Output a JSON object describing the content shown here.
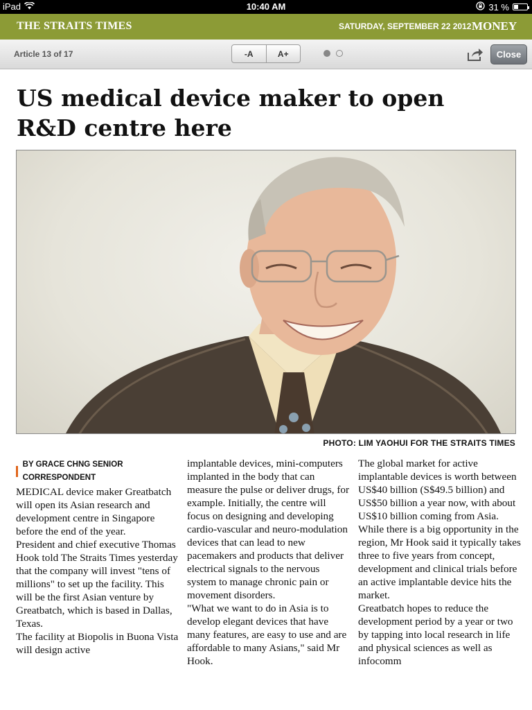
{
  "status_bar": {
    "device": "iPad",
    "time": "10:40 AM",
    "battery": "31 %",
    "battery_level": 0.31
  },
  "masthead": {
    "brand": "THE STRAITS TIMES",
    "date": "SATURDAY, SEPTEMBER 22 2012",
    "section": "MONEY"
  },
  "toolbar": {
    "article_count": "Article 13 of 17",
    "font_decrease": "-A",
    "font_increase": "A+",
    "close": "Close",
    "page_dots": {
      "current": 1,
      "total": 2
    }
  },
  "article": {
    "headline": "US medical device maker to open R&D centre here",
    "photo_credit": "PHOTO: LIM YAOHUI FOR THE STRAITS TIMES",
    "byline": "BY GRACE CHNG SENIOR CORRESPONDENT",
    "paragraphs": [
      "MEDICAL device maker Greatbatch will open its Asian research and development centre in Singapore before the end of the year.",
      " President and chief executive Thomas Hook told The Straits Times yesterday that the company will invest \"tens of millions\" to set up the facility. This will be the first Asian venture by Greatbatch, which is based in Dallas, Texas.",
      " The facility at Biopolis in Buona Vista will design active",
      "implantable devices, mini-computers implanted in the body that can measure the pulse or deliver drugs, for example. Initially, the centre will focus on designing and developing cardio-vascular and neuro-modulation devices that can lead to new pacemakers and products that deliver electrical signals to the nervous system to manage chronic pain or movement disorders.",
      "\"What we want to do in Asia is to develop elegant devices that have many features, are easy to use and are affordable to many Asians,\" said Mr Hook.",
      " The global market for active implantable devices is worth between US$40 billion (S$49.5 billion) and US$50 billion a year now, with about US$10 billion coming from Asia.",
      " While there is a big opportunity in the region, Mr Hook said it typically takes three to five years from concept, development and clinical trials before an active implantable device hits the market.",
      " Greatbatch hopes to reduce the development period by a year or two by tapping into local research in life and physical sciences as well as infocomm"
    ]
  },
  "colors": {
    "masthead_green": "#8c9b36",
    "byline_accent": "#e0651a"
  }
}
